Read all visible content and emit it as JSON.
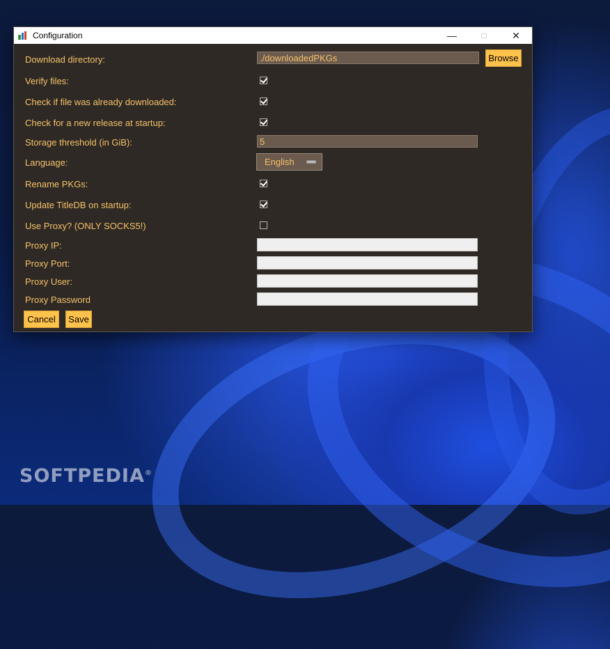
{
  "window": {
    "title": "Configuration"
  },
  "form": {
    "download_dir": {
      "label": "Download directory:",
      "value": "./downloadedPKGs",
      "browse_label": "Browse"
    },
    "verify_files": {
      "label": "Verify files:",
      "checked": true
    },
    "check_downloaded": {
      "label": "Check if file was already downloaded:",
      "checked": true
    },
    "check_release": {
      "label": "Check for a new release at startup:",
      "checked": true
    },
    "storage_threshold": {
      "label": "Storage threshold (in GiB):",
      "value": "5"
    },
    "language": {
      "label": "Language:",
      "selected": "English"
    },
    "rename_pkgs": {
      "label": "Rename PKGs:",
      "checked": true
    },
    "update_titledb": {
      "label": "Update TitleDB on startup:",
      "checked": true
    },
    "use_proxy": {
      "label": "Use Proxy? (ONLY SOCKS5!)",
      "checked": false
    },
    "proxy_ip": {
      "label": "Proxy IP:",
      "value": ""
    },
    "proxy_port": {
      "label": "Proxy Port:",
      "value": ""
    },
    "proxy_user": {
      "label": "Proxy User:",
      "value": ""
    },
    "proxy_password": {
      "label": "Proxy Password",
      "value": ""
    }
  },
  "buttons": {
    "cancel": "Cancel",
    "save": "Save"
  },
  "watermark": "SOFTPEDIA",
  "watermark_mark": "®",
  "colors": {
    "window_bg": "#2e2924",
    "label": "#f5c26b",
    "button": "#ffc24a",
    "field_dark": "#6b5a4e"
  }
}
